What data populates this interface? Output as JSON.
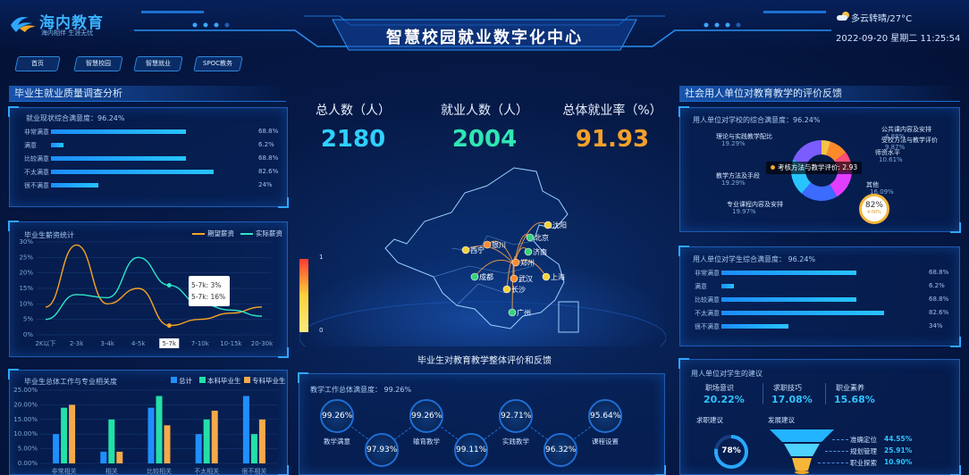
{
  "header": {
    "logo_name": "海内教育",
    "logo_slogan": "海内相伴 生涯无忧",
    "title": "智慧校园就业数字化中心",
    "weather": "多云转晴/27°C",
    "datetime": "2022-09-20 星期二 11:25:54"
  },
  "nav": [
    "首页",
    "智慧校园",
    "智慧就业",
    "SPOC教务"
  ],
  "left1": {
    "title": "毕业生就业质量调查分析",
    "subtitle": "就业现状综合满意度：96.24%",
    "rows": [
      {
        "label": "非常满意",
        "value": "68.8%",
        "pct": 68.8
      },
      {
        "label": "满意",
        "value": "6.2%",
        "pct": 6.2
      },
      {
        "label": "比较满意",
        "value": "68.8%",
        "pct": 68.8
      },
      {
        "label": "不太满意",
        "value": "82.6%",
        "pct": 82.6
      },
      {
        "label": "很不满意",
        "value": "24%",
        "pct": 24
      }
    ]
  },
  "left2": {
    "title": "毕业生薪资统计",
    "legend": [
      "期望薪资",
      "实际薪资"
    ],
    "tooltip": [
      "5-7k: 3%",
      "5-7k: 16%"
    ],
    "chart_data": {
      "type": "line",
      "categories": [
        "2K以下",
        "2-3k",
        "3-4k",
        "4-5k",
        "5-7k",
        "7-10k",
        "10-15k",
        "20-30k"
      ],
      "ylim": [
        0,
        30
      ],
      "yticks": [
        "0%",
        "5%",
        "10%",
        "15%",
        "20%",
        "25%",
        "30%"
      ],
      "series": [
        {
          "name": "期望薪资",
          "color": "#f5a623",
          "values": [
            9,
            29,
            10,
            15,
            3,
            5,
            7,
            9
          ]
        },
        {
          "name": "实际薪资",
          "color": "#2ee6c8",
          "values": [
            5,
            13,
            12,
            25,
            16,
            10,
            8,
            6
          ]
        }
      ]
    }
  },
  "left3": {
    "title": "毕业生总体工作与专业相关度",
    "legend": [
      "总计",
      "本科毕业生",
      "专科毕业生"
    ],
    "chart_data": {
      "type": "bar",
      "categories": [
        "非常相关",
        "相关",
        "比较相关",
        "不太相关",
        "很不相关"
      ],
      "ylim": [
        0,
        25
      ],
      "yticks": [
        "0.00%",
        "5.00%",
        "10.00%",
        "15.00%",
        "20.00%",
        "25.00%"
      ],
      "series": [
        {
          "name": "总计",
          "color": "#1f8fff",
          "values": [
            10,
            4,
            19,
            10,
            23
          ]
        },
        {
          "name": "本科毕业生",
          "color": "#23e0a8",
          "values": [
            19,
            15,
            23,
            15,
            10
          ]
        },
        {
          "name": "专科毕业生",
          "color": "#f5a94a",
          "values": [
            20,
            4,
            13,
            18,
            15
          ]
        }
      ]
    }
  },
  "center": {
    "kpis": [
      {
        "label": "总人数（人）",
        "value": "2180",
        "color": "#2fd0ff"
      },
      {
        "label": "就业人数（人）",
        "value": "2004",
        "color": "#2fe6b4"
      },
      {
        "label": "总体就业率（%）",
        "value": "91.93",
        "color": "#f5a12a"
      }
    ],
    "legend_max": "1",
    "legend_min": "0",
    "cities": [
      "沈阳",
      "北京",
      "银川",
      "西宁",
      "济南",
      "郑州",
      "上海",
      "成都",
      "武汉",
      "长沙",
      "广州"
    ],
    "bottom_title": "毕业生对教育教学整体评价和反馈",
    "satisfaction": "教学工作总体满意度：  99.26%",
    "circles": [
      {
        "value": "99.26%",
        "label": "教学满意"
      },
      {
        "value": "97.93%",
        "label": ""
      },
      {
        "value": "99.26%",
        "label": "输育教学"
      },
      {
        "value": "99.11%",
        "label": ""
      },
      {
        "value": "92.71%",
        "label": "实践教学"
      },
      {
        "value": "96.32%",
        "label": ""
      },
      {
        "value": "95.64%",
        "label": "课程设置"
      }
    ]
  },
  "right1": {
    "title": "社会用人单位对教育教学的评价反馈",
    "subtitle": "用人单位对学校的综合满意度：96.24%",
    "tooltip": "考核方法与教学评价: 2.93",
    "gauge": "82%",
    "gauge_sub": "4.00%",
    "chart_data": {
      "type": "pie",
      "labels": [
        "公共课内容及安排",
        "受校方法与教学评价",
        "师资水平",
        "其他",
        "专业课程内容及安排",
        "教学方法及手段",
        "理论与实践教学配比"
      ],
      "values": [
        4.88,
        9.87,
        10.61,
        16.09,
        19.97,
        19.29,
        19.29
      ],
      "colors": [
        "#f5c24a",
        "#ff8a2a",
        "#ff4d7a",
        "#e23dff",
        "#3b6cff",
        "#27c4ff",
        "#7a5cff"
      ],
      "labels_text": [
        "公共课内容及安排",
        "4.88%",
        "受校方法与教学评价",
        "9.87%",
        "师资水平",
        "10.61%",
        "其他",
        "16.09%",
        "专业课程内容及安排",
        "19.97%",
        "教学方法及手段",
        "19.29%",
        "理论与实践教学配比",
        "19.29%"
      ]
    }
  },
  "right2": {
    "subtitle": "用人单位对学生综合满意度：  96.24%",
    "rows": [
      {
        "label": "非常满意",
        "value": "68.8%",
        "pct": 68.8
      },
      {
        "label": "满意",
        "value": "6.2%",
        "pct": 6.2
      },
      {
        "label": "比较满意",
        "value": "68.8%",
        "pct": 68.8
      },
      {
        "label": "不太满意",
        "value": "82.6%",
        "pct": 82.6
      },
      {
        "label": "很不满意",
        "value": "34%",
        "pct": 34
      }
    ]
  },
  "right3": {
    "subtitle": "用人单位对学生的建议",
    "stats": [
      {
        "label": "职场意识",
        "value": "20.22%"
      },
      {
        "label": "求职技巧",
        "value": "17.08%"
      },
      {
        "label": "职业素养",
        "value": "15.68%"
      }
    ],
    "left_label": "求职建议",
    "right_label": "发展建议",
    "donut": "78%",
    "funnel": [
      {
        "label": "准确定位",
        "value": "44.55%"
      },
      {
        "label": "规划管理",
        "value": "25.91%"
      },
      {
        "label": "职业探索",
        "value": "10.90%"
      }
    ]
  }
}
